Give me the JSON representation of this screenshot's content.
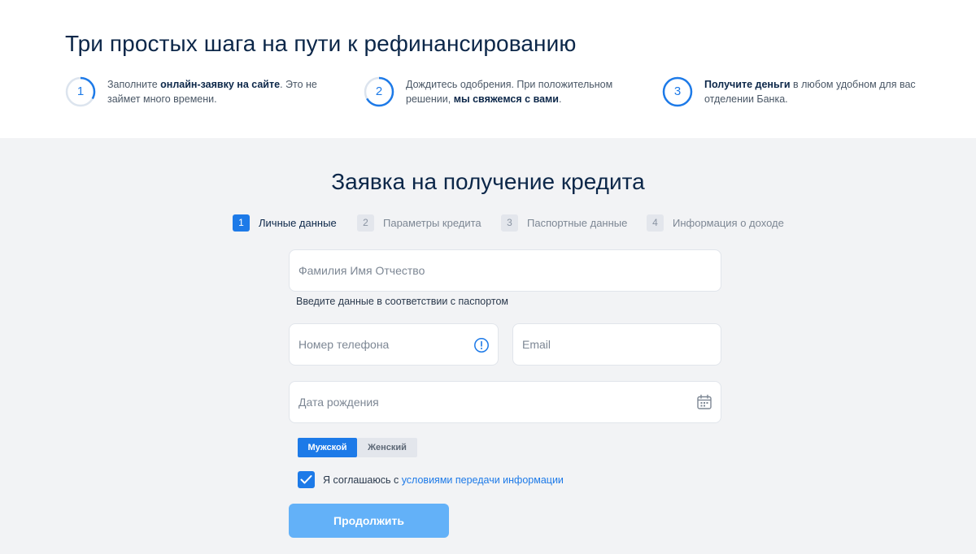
{
  "header": {
    "title": "Три простых шага на пути к рефинансированию"
  },
  "steps": [
    {
      "num": "1",
      "before": "Заполните ",
      "bold": "онлайн-заявку на сайте",
      "after": ". Это не займет много времени."
    },
    {
      "num": "2",
      "before": "Дождитесь одобрения. При положительном решении, ",
      "bold": "мы свяжемся с вами",
      "after": "."
    },
    {
      "num": "3",
      "before": "",
      "bold": "Получите деньги",
      "after": " в любом удобном для вас отделении Банка."
    }
  ],
  "form": {
    "title": "Заявка на получение кредита",
    "wizard": [
      {
        "num": "1",
        "label": "Личные данные"
      },
      {
        "num": "2",
        "label": "Параметры кредита"
      },
      {
        "num": "3",
        "label": "Паспортные данные"
      },
      {
        "num": "4",
        "label": "Информация о доходе"
      }
    ],
    "fio_placeholder": "Фамилия Имя Отчество",
    "fio_hint": "Введите данные в соответствии с паспортом",
    "phone_placeholder": "Номер телефона",
    "email_placeholder": "Email",
    "birth_placeholder": "Дата рождения",
    "gender_male": "Мужской",
    "gender_female": "Женский",
    "agree_prefix": "Я соглашаюсь с ",
    "agree_link": "условиями передачи информации",
    "submit_label": "Продолжить"
  },
  "icons": {
    "phone_info": "info-circle-icon",
    "birth_date": "calendar-icon",
    "checkbox": "checkmark-icon"
  },
  "colors": {
    "accent": "#1d7ae8",
    "heading": "#0c2749",
    "form_bg": "#f2f3f5",
    "submit_disabled": "#63b1f8"
  }
}
